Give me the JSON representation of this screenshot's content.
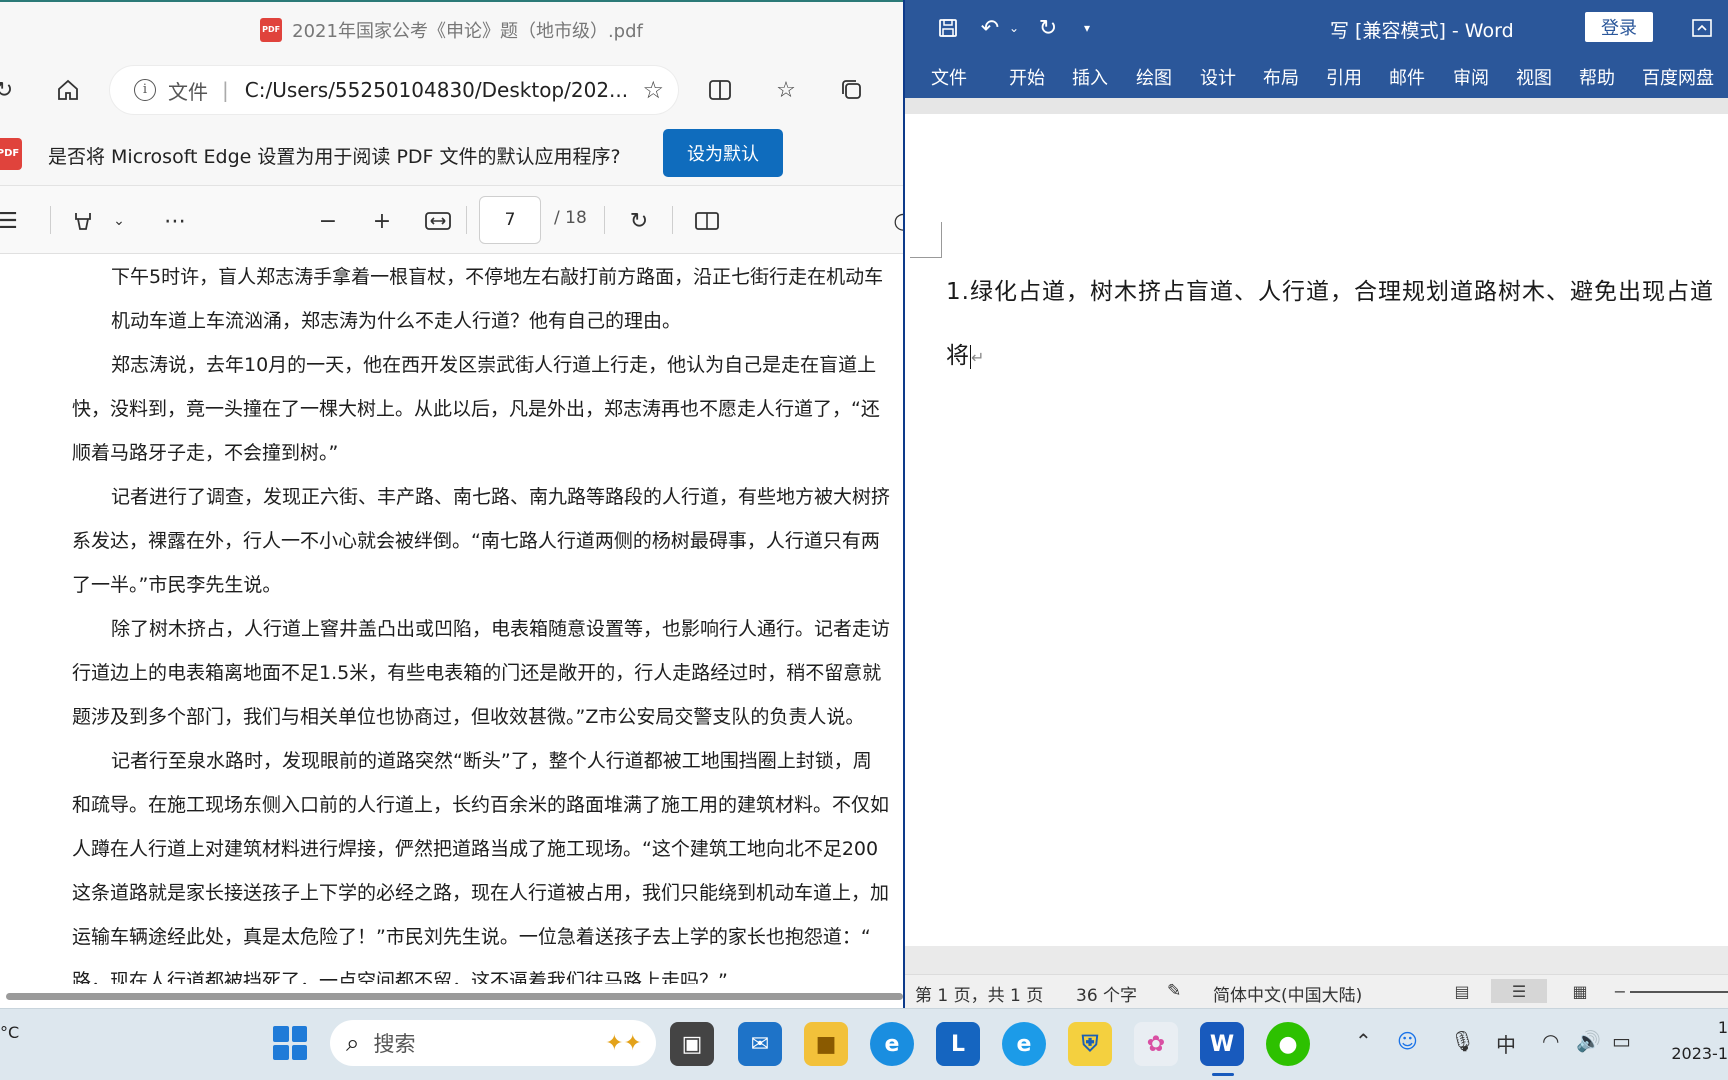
{
  "edge": {
    "tab_title": "2021年国家公考《申论》题（地市级）.pdf",
    "address_label": "文件",
    "address_url": "C:/Users/55250104830/Desktop/202...",
    "infobar_message": "是否将 Microsoft Edge 设置为用于阅读 PDF 文件的默认应用程序?",
    "infobar_button": "设为默认",
    "page_current": "7",
    "page_total": "/ 18",
    "pdf_lines": [
      "下午5时许，盲人郑志涛手拿着一根盲杖，不停地左右敲打前方路面，沿正七街行走在机动车",
      "机动车道上车流汹涌，郑志涛为什么不走人行道？他有自己的理由。",
      "郑志涛说，去年10月的一天，他在西开发区崇武街人行道上行走，他认为自己是走在盲道上",
      "快，没料到，竟一头撞在了一棵大树上。从此以后，凡是外出，郑志涛再也不愿走人行道了，“还",
      "顺着马路牙子走，不会撞到树。”",
      "记者进行了调查，发现正六街、丰产路、南七路、南九路等路段的人行道，有些地方被大树挤",
      "系发达，裸露在外，行人一不小心就会被绊倒。“南七路人行道两侧的杨树最碍事，人行道只有两",
      "了一半。”市民李先生说。",
      "除了树木挤占，人行道上窨井盖凸出或凹陷，电表箱随意设置等，也影响行人通行。记者走访",
      "行道边上的电表箱离地面不足1.5米，有些电表箱的门还是敞开的，行人走路经过时，稍不留意就",
      "题涉及到多个部门，我们与相关单位也协商过，但收效甚微。”Z市公安局交警支队的负责人说。",
      "记者行至泉水路时，发现眼前的道路突然“断头”了，整个人行道都被工地围挡圈上封锁，周",
      "和疏导。在施工现场东侧入口前的人行道上，长约百余米的路面堆满了施工用的建筑材料。不仅如",
      "人蹲在人行道上对建筑材料进行焊接，俨然把道路当成了施工现场。“这个建筑工地向北不足200",
      "这条道路就是家长接送孩子上下学的必经之路，现在人行道被占用，我们只能绕到机动车道上，加",
      "运输车辆途经此处，真是太危险了！”市民刘先生说。一位急着送孩子去上学的家长也抱怨道：“",
      "路，现在人行道都被挡死了，一点空间都不留，这不逼着我们往马路上走吗？”"
    ]
  },
  "word": {
    "doc_title": "写 [兼容模式]  -  Word",
    "login": "登录",
    "tabs": [
      "文件",
      "开始",
      "插入",
      "绘图",
      "设计",
      "布局",
      "引用",
      "邮件",
      "审阅",
      "视图",
      "帮助",
      "百度网盘"
    ],
    "body_line1": "1.绿化占道，树木挤占盲道、人行道，合理规划道路树木、避免出现占道",
    "body_line2": "将",
    "status_page": "第 1 页，共 1 页",
    "status_words": "36 个字",
    "status_lang": "简体中文(中国大陆)"
  },
  "taskbar": {
    "weather": "°C",
    "search_placeholder": "搜索",
    "ime": "中",
    "clock_time": "1",
    "clock_date": "2023-1"
  }
}
